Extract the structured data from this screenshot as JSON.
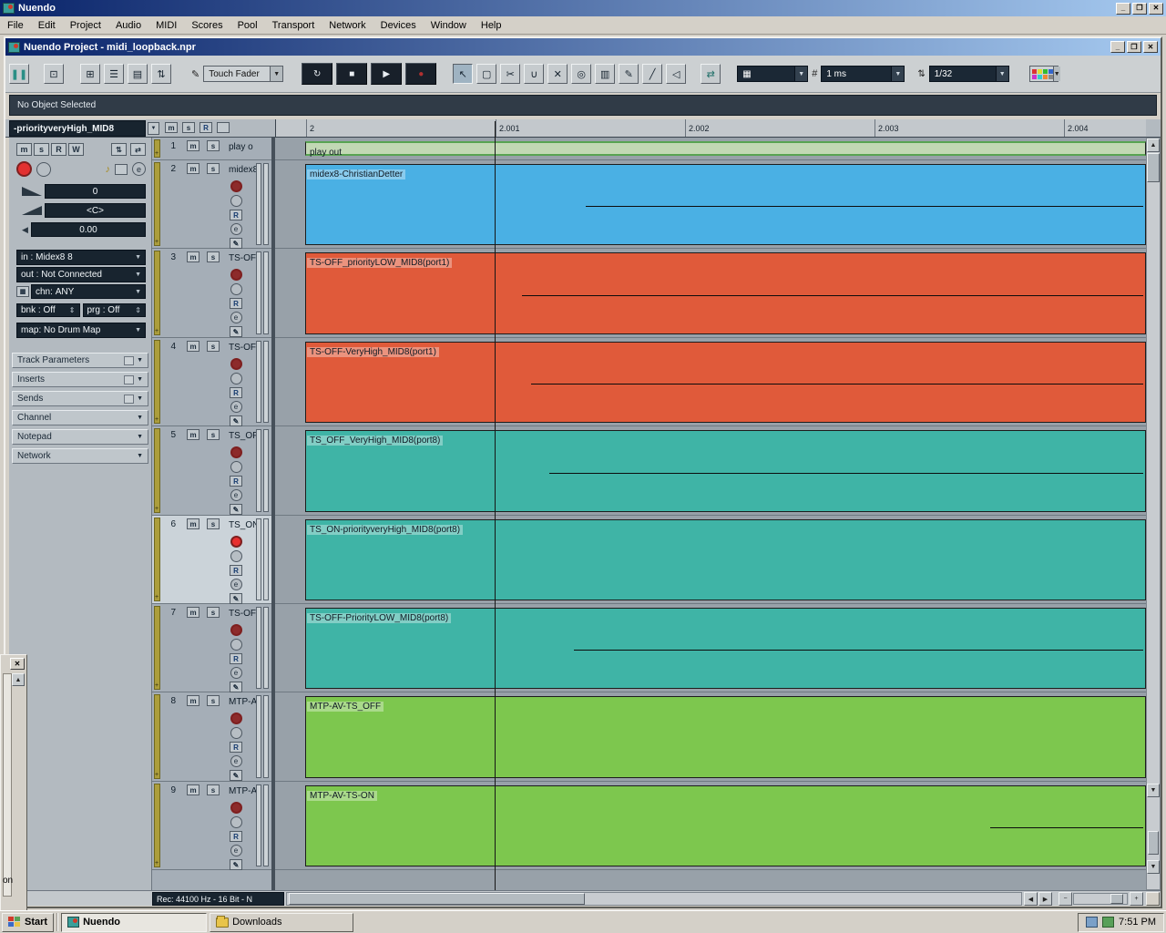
{
  "colors": {
    "titlebar_gradient_left": "#0a246a",
    "titlebar_gradient_right": "#a6caf0",
    "window_gray": "#d4d0c8",
    "clip_blue": "#4ab0e4",
    "clip_red": "#e05a3a",
    "clip_teal": "#3fb4a6",
    "clip_green": "#7dc74e",
    "track_color_strip": "#ac9e3c",
    "dark_field": "#18242f"
  },
  "icons": {
    "minimize": "_",
    "restore": "❐",
    "maximize": "□",
    "close": "✕",
    "dropdown": "▼",
    "up": "▲",
    "down": "▼",
    "left": "◀",
    "right": "▶",
    "plus": "+",
    "minus": "−",
    "cycle": "↻",
    "stop": "■",
    "play": "▶",
    "record": "●",
    "select": "↖",
    "range": "▢",
    "split": "✂",
    "glue": "∪",
    "erase": "✕",
    "zoom": "◎",
    "mute": "▥",
    "draw": "✎",
    "line": "╱",
    "speaker": "◁",
    "autoscroll": "⇄",
    "grid": "▦",
    "hash": "#",
    "note": "♪",
    "pencil": "✎",
    "spin": "⇕",
    "bars": "❚❚",
    "layout": "⊡",
    "inspector_toggle": "⊞",
    "infoline_toggle": "☰",
    "overview_toggle": "▤",
    "updown": "⇅"
  },
  "app": {
    "title": "Nuendo",
    "menus": [
      "File",
      "Edit",
      "Project",
      "Audio",
      "MIDI",
      "Scores",
      "Pool",
      "Transport",
      "Network",
      "Devices",
      "Window",
      "Help"
    ]
  },
  "project": {
    "title": "Nuendo Project - midi_loopback.npr"
  },
  "toolbar": {
    "automation_mode": "Touch Fader",
    "grid_value": "1 ms",
    "quantize_value": "1/32"
  },
  "info_line": "No Object Selected",
  "inspector": {
    "track_name": "-priorityveryHigh_MID8",
    "mute": "m",
    "solo": "s",
    "read": "R",
    "write": "W",
    "edit": "e",
    "volume": "0",
    "pan": "<C>",
    "delay": "0.00",
    "in_label": "in :",
    "in_value": "Midex8 8",
    "out_label": "out :",
    "out_value": "Not Connected",
    "chn_label": "chn:",
    "chn_value": "ANY",
    "bnk_label": "bnk :",
    "bnk_value": "Off",
    "prg_label": "prg :",
    "prg_value": "Off",
    "map_label": "map:",
    "map_value": "No Drum Map",
    "sections": [
      "Track Parameters",
      "Inserts",
      "Sends",
      "Channel",
      "Notepad",
      "Network"
    ]
  },
  "track_controls": {
    "mute": "m",
    "solo": "s",
    "read": "R",
    "edit": "e"
  },
  "ruler": {
    "ticks": [
      "2",
      "2.001",
      "2.002",
      "2.003",
      "2.004"
    ]
  },
  "tracks": [
    {
      "num": "1",
      "list_name": "play o",
      "clip_label": "play out"
    },
    {
      "num": "2",
      "list_name": "midex8",
      "clip_label": "midex8-ChristianDetter"
    },
    {
      "num": "3",
      "list_name": "TS-OF",
      "clip_label": "TS-OFF_priorityLOW_MID8(port1)"
    },
    {
      "num": "4",
      "list_name": "TS-OF",
      "clip_label": "TS-OFF-VeryHigh_MID8(port1)"
    },
    {
      "num": "5",
      "list_name": "TS_OF",
      "clip_label": "TS_OFF_VeryHigh_MID8(port8)"
    },
    {
      "num": "6",
      "list_name": "TS_ON",
      "clip_label": "TS_ON-priorityveryHigh_MID8(port8)"
    },
    {
      "num": "7",
      "list_name": "TS-OF",
      "clip_label": "TS-OFF-PriorityLOW_MID8(port8)"
    },
    {
      "num": "8",
      "list_name": "MTP-A",
      "clip_label": "MTP-AV-TS_OFF"
    },
    {
      "num": "9",
      "list_name": "MTP-A",
      "clip_label": "MTP-AV-TS-ON"
    }
  ],
  "status_bar": {
    "record_format": "Rec: 44100 Hz - 16 Bit - N"
  },
  "taskbar": {
    "start": "Start",
    "task_nuendo": "Nuendo",
    "task_downloads": "Downloads",
    "time": "7:51 PM"
  },
  "palette": {
    "label": "on"
  }
}
